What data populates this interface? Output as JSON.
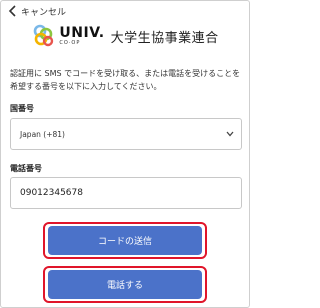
{
  "nav": {
    "cancel_label": "キャンセル"
  },
  "brand": {
    "univ": "UNIV.",
    "coop": "CO·OP",
    "org_name": "大学生協事業連合"
  },
  "instructions": "認証用に SMS でコードを受け取る、または電話を受けることを希望する番号を以下に入力してください。",
  "form": {
    "country_label": "国番号",
    "country_selected": "Japan (+81)",
    "phone_label": "電話番号",
    "phone_value": "09012345678"
  },
  "actions": {
    "send_code_label": "コードの送信",
    "call_label": "電話する"
  },
  "colors": {
    "primary": "#4b72c9",
    "highlight": "#e0152a"
  },
  "icons": [
    "back-chevron-icon",
    "univcoop-logo-icon",
    "chevron-down-icon"
  ]
}
